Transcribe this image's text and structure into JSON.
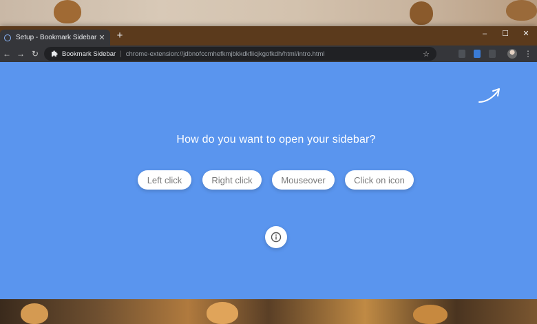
{
  "browser": {
    "tab_title": "Setup - Bookmark Sidebar",
    "tab_close": "✕",
    "new_tab": "+",
    "window_controls": {
      "minimize": "–",
      "maximize": "☐",
      "close": "✕"
    },
    "nav": {
      "back": "←",
      "forward": "→",
      "reload": "↻"
    },
    "omnibox": {
      "site_name": "Bookmark Sidebar",
      "divider": "|",
      "url": "chrome-extension://jdbnofccmhefkmjbkkdkfiicjkgofkdh/html/intro.html",
      "star": "☆"
    },
    "menu": "⋮"
  },
  "page": {
    "question": "How do you want to open your sidebar?",
    "options": [
      {
        "label": "Left click"
      },
      {
        "label": "Right click"
      },
      {
        "label": "Mouseover"
      },
      {
        "label": "Click on icon"
      }
    ]
  },
  "colors": {
    "page_background": "#5a95ee",
    "titlebar": "#5b3a1c",
    "toolbar": "#35363a"
  },
  "icons": [
    "extension-puzzle-icon",
    "curved-arrow-icon",
    "info-icon",
    "star-icon"
  ]
}
